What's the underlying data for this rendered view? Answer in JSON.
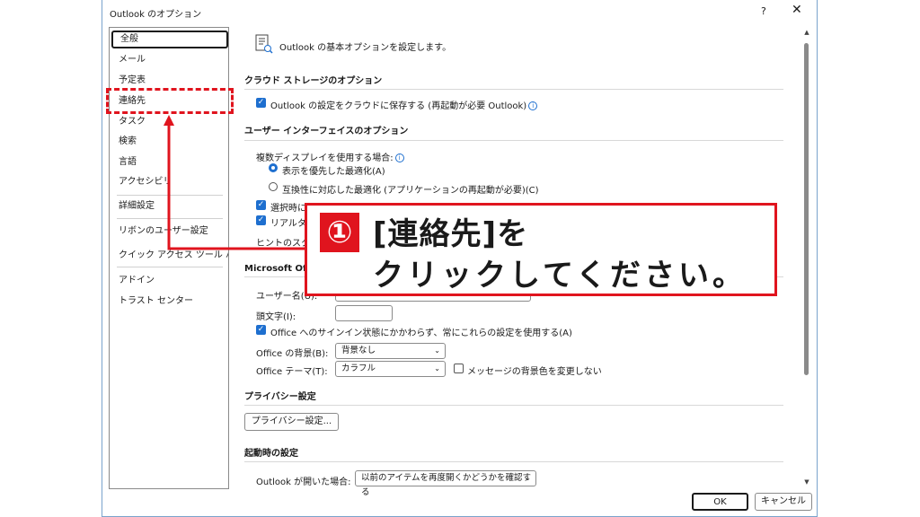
{
  "window": {
    "title": "Outlook のオプション",
    "help": "?",
    "close": "✕"
  },
  "sidebar": {
    "items": [
      {
        "label": "全般"
      },
      {
        "label": "メール"
      },
      {
        "label": "予定表"
      },
      {
        "label": "連絡先"
      },
      {
        "label": "タスク"
      },
      {
        "label": "検索"
      },
      {
        "label": "言語"
      },
      {
        "label": "アクセシビリティ"
      },
      {
        "label": "詳細設定"
      },
      {
        "label": "リボンのユーザー設定"
      },
      {
        "label": "クイック アクセス ツール バー"
      },
      {
        "label": "アドイン"
      },
      {
        "label": "トラスト センター"
      }
    ]
  },
  "main": {
    "intro": "Outlook の基本オプションを設定します。",
    "cloud": {
      "header": "クラウド ストレージのオプション",
      "save_to_cloud": "Outlook の設定をクラウドに保存する (再起動が必要 Outlook)"
    },
    "ui": {
      "header": "ユーザー インターフェイスのオプション",
      "multi_display": "複数ディスプレイを使用する場合:",
      "opt_display": "表示を優先した最適化(A)",
      "opt_compat": "互換性に対応した最適化 (アプリケーションの再起動が必要)(C)",
      "mini_toolbar": "選択時にミニ ツール バーを表示する(M)",
      "live_preview": "リアルタイムのプレビュー表示機能を有効にする(L)",
      "tooltip_style": "ヒントのスタイル(R):"
    },
    "office": {
      "header": "Microsoft Office のユーザー設定",
      "username_label": "ユーザー名(U):",
      "username_value": "",
      "initials_label": "頭文字(I):",
      "initials_value": "",
      "always_use": "Office へのサインイン状態にかかわらず、常にこれらの設定を使用する(A)",
      "background_label": "Office の背景(B):",
      "background_value": "背景なし",
      "theme_label": "Office テーマ(T):",
      "theme_value": "カラフル",
      "no_change_bg": "メッセージの背景色を変更しない"
    },
    "privacy": {
      "header": "プライバシー設定",
      "button": "プライバシー設定..."
    },
    "startup": {
      "header": "起動時の設定",
      "label": "Outlook が開いた場合:",
      "value": "以前のアイテムを再度開くかどうかを確認する"
    }
  },
  "footer": {
    "ok": "OK",
    "cancel": "キャンセル"
  },
  "annotation": {
    "number": "①",
    "line1": "[連絡先]を",
    "line2": "クリックしてください。",
    "color": "#e0141e"
  }
}
